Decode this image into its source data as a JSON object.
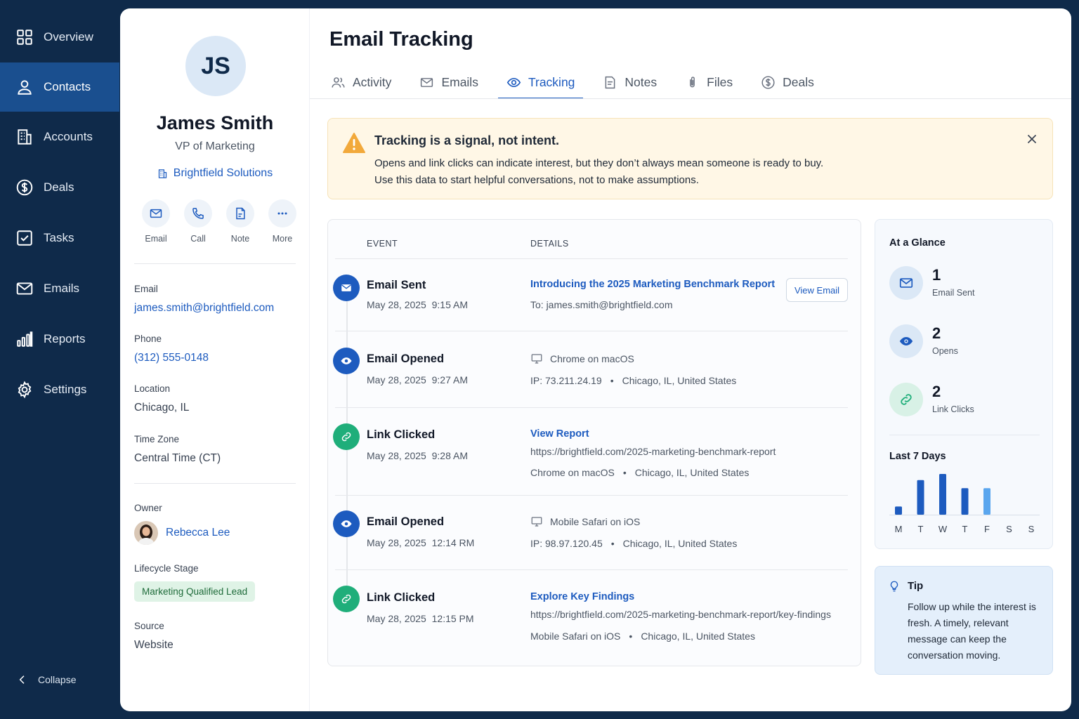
{
  "sidebar": {
    "items": [
      {
        "label": "Overview",
        "icon": "grid-icon"
      },
      {
        "label": "Contacts",
        "icon": "person-icon",
        "active": true
      },
      {
        "label": "Accounts",
        "icon": "building-icon"
      },
      {
        "label": "Deals",
        "icon": "dollar-icon"
      },
      {
        "label": "Tasks",
        "icon": "checkbox-icon"
      },
      {
        "label": "Emails",
        "icon": "envelope-icon"
      },
      {
        "label": "Reports",
        "icon": "bar-chart-icon"
      },
      {
        "label": "Settings",
        "icon": "gear-icon"
      }
    ],
    "collapse_label": "Collapse"
  },
  "profile": {
    "initials": "JS",
    "name": "James Smith",
    "title": "VP of Marketing",
    "company": "Brightfield Solutions",
    "actions": [
      "Email",
      "Call",
      "Note",
      "More"
    ],
    "email_label": "Email",
    "email": "james.smith@brightfield.com",
    "phone_label": "Phone",
    "phone": "(312) 555-0148",
    "location_label": "Location",
    "location": "Chicago, IL",
    "timezone_label": "Time Zone",
    "timezone": "Central Time (CT)",
    "owner_label": "Owner",
    "owner": "Rebecca Lee",
    "lifecycle_label": "Lifecycle Stage",
    "lifecycle": "Marketing Qualified Lead",
    "source_label": "Source",
    "source": "Website"
  },
  "header": {
    "title": "Email Tracking",
    "tabs": [
      {
        "label": "Activity"
      },
      {
        "label": "Emails"
      },
      {
        "label": "Tracking",
        "active": true
      },
      {
        "label": "Notes"
      },
      {
        "label": "Files"
      },
      {
        "label": "Deals"
      }
    ]
  },
  "alert": {
    "title": "Tracking is a signal, not intent.",
    "line1": "Opens and link clicks can indicate interest, but they don’t always mean someone is ready to buy.",
    "line2": "Use this data to start helpful conversations, not to make assumptions."
  },
  "timeline": {
    "col_event": "EVENT",
    "col_details": "DETAILS",
    "events": [
      {
        "title": "Email Sent",
        "date": "May 28, 2025",
        "time": "9:15 AM",
        "link": "Introducing the 2025 Marketing Benchmark Report",
        "line2": "To: james.smith@brightfield.com",
        "button": "View Email"
      },
      {
        "title": "Email Opened",
        "date": "May 28, 2025",
        "time": "9:27 AM",
        "device": "Chrome on macOS",
        "ip": "IP: 73.211.24.19",
        "place": "Chicago, IL, United States"
      },
      {
        "title": "Link Clicked",
        "date": "May 28, 2025",
        "time": "9:28 AM",
        "link": "View Report",
        "url": "https://brightfield.com/2025-marketing-benchmark-report",
        "device": "Chrome on macOS",
        "place": "Chicago, IL, United States"
      },
      {
        "title": "Email Opened",
        "date": "May 28, 2025",
        "time": "12:14 RM",
        "device": "Mobile Safari on iOS",
        "ip": "IP: 98.97.120.45",
        "place": "Chicago, IL, United States"
      },
      {
        "title": "Link Clicked",
        "date": "May 28, 2025",
        "time": "12:15 PM",
        "link": "Explore Key Findings",
        "url": "https://brightfield.com/2025-marketing-benchmark-report/key-findings",
        "device": "Mobile Safari on iOS",
        "place": "Chicago, IL, United States"
      }
    ]
  },
  "glance": {
    "title": "At a Glance",
    "stats": [
      {
        "value": "1",
        "label": "Email Sent"
      },
      {
        "value": "2",
        "label": "Opens"
      },
      {
        "value": "2",
        "label": "Link Clicks"
      }
    ],
    "chart_title": "Last 7 Days"
  },
  "chart_data": {
    "type": "bar",
    "title": "Last 7 Days",
    "categories": [
      "M",
      "T",
      "W",
      "T",
      "F",
      "S",
      "S"
    ],
    "values": [
      0.2,
      0.85,
      1.0,
      0.65,
      0.65,
      0,
      0
    ],
    "ylim": [
      0,
      1
    ],
    "colors": [
      "#1d5bbf",
      "#1d5bbf",
      "#1d5bbf",
      "#1d5bbf",
      "#5aa6ee",
      "#1d5bbf",
      "#1d5bbf"
    ]
  },
  "tip": {
    "title": "Tip",
    "text": "Follow up while the interest is fresh. A timely, relevant message can keep the conversation moving."
  },
  "colors": {
    "sidebar": "#0f2a4a",
    "sidebar_active": "#1a4f8f",
    "accent": "#1d5bbf",
    "green": "#1fae7a",
    "alert_bg": "#fff7e6"
  }
}
